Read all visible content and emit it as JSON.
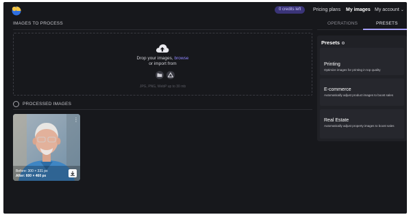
{
  "header": {
    "credits": "0 credits left",
    "nav": {
      "pricing": "Pricing plans",
      "my_images": "My images",
      "account": "My account"
    }
  },
  "upload": {
    "title": "IMAGES TO PROCESS",
    "drop_text": "Drop your images, ",
    "browse_link": "browse",
    "import_text": "or import from",
    "formats_hint": "JPG, PNG, WebP up to 30 mb"
  },
  "processed": {
    "title": "PROCESSED IMAGES",
    "items": [
      {
        "before": "Before: 300 × 331 px",
        "after": "After: 600 × 460 px"
      }
    ]
  },
  "tabs": {
    "operations": "OPERATIONS",
    "presets": "PRESETS",
    "active": "presets"
  },
  "presets": {
    "heading": "Presets",
    "items": [
      {
        "name": "Printing",
        "description": "Optimize images for printing in top quality"
      },
      {
        "name": "E-commerce",
        "description": "Automatically adjust product images to boost sales"
      },
      {
        "name": "Real Estate",
        "description": "Automatically adjust property images to boost sales"
      }
    ]
  },
  "colors": {
    "background": "#17181c",
    "panel": "#202126",
    "accent": "#8f86ff",
    "credits_badge": "#3a3478"
  },
  "icons": {
    "logo": "brand-logo",
    "upload": "cloud-upload-icon",
    "folder": "folder-icon",
    "drive": "google-drive-icon",
    "menu": "more-vertical-icon",
    "download": "download-icon",
    "account_menu": "chevron-down-icon",
    "info": "info-icon"
  }
}
